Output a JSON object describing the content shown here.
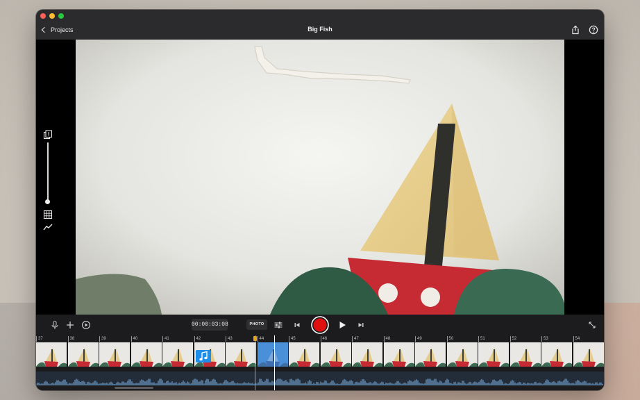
{
  "window": {
    "title": "Big Fish",
    "back_label": "Projects"
  },
  "toolbar_icons": [
    "share-icon",
    "help-icon"
  ],
  "viewer_rail": {
    "icons": [
      "layers-icon",
      "grid-overlay-icon",
      "graph-icon"
    ],
    "slider_level": 1.0
  },
  "controls": {
    "timecode": "00:00:03:08",
    "photo_label": "PHOTO",
    "icons": [
      "microphone-icon",
      "plus-icon",
      "playback-speed-icon",
      "adjust-icon",
      "skip-back-icon",
      "record-icon",
      "play-icon",
      "skip-forward-icon",
      "fullscreen-icon"
    ],
    "record_color": "#e01010"
  },
  "timeline": {
    "ruler_labels": [
      "37",
      "38",
      "39",
      "40",
      "41",
      "42",
      "43",
      "44",
      "45",
      "46",
      "47",
      "48",
      "49",
      "50",
      "51",
      "52",
      "53",
      "54"
    ],
    "frame_count": 18,
    "selected_frame": "44",
    "music_frame": "42",
    "selection_color": "#4a90d9",
    "playhead_color": "#e6a21a"
  }
}
